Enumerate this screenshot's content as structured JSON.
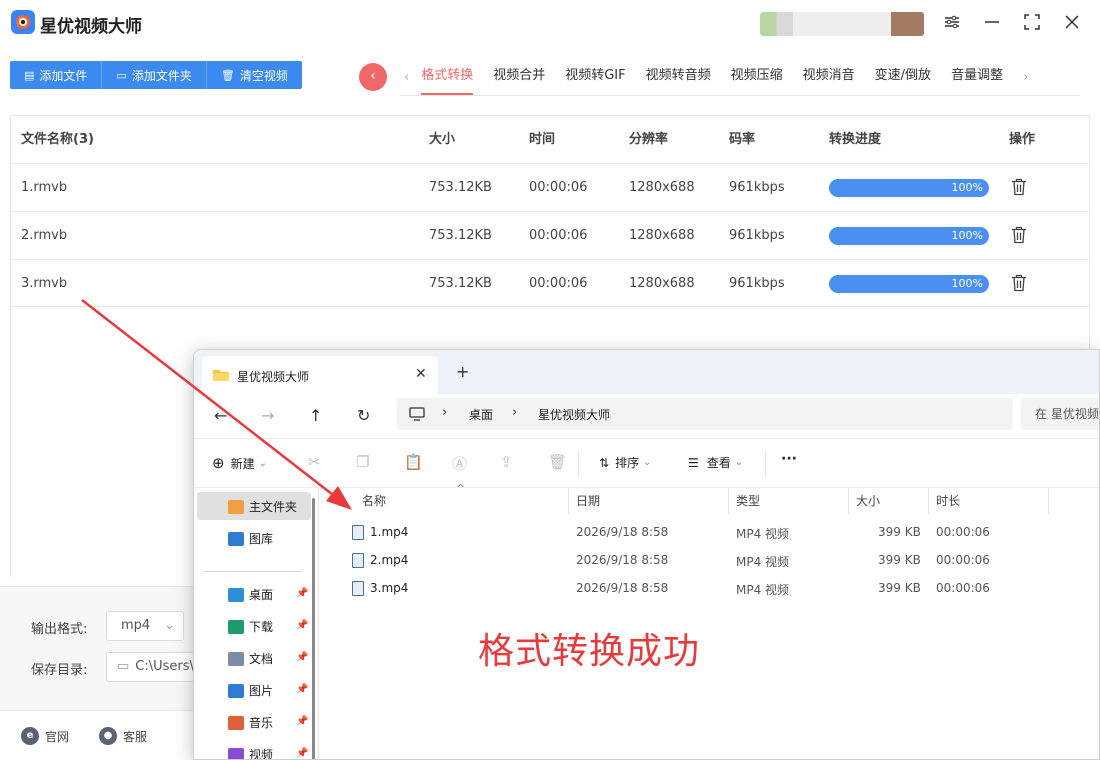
{
  "app": {
    "title": "星优视频大师",
    "toolbar": {
      "add_file": "添加文件",
      "add_folder": "添加文件夹",
      "clear_videos": "清空视频"
    },
    "tabs": [
      "格式转换",
      "视频合并",
      "视频转GIF",
      "视频转音频",
      "视频压缩",
      "视频消音",
      "变速/倒放",
      "音量调整"
    ],
    "active_tab": "格式转换",
    "table": {
      "headers": {
        "name": "文件名称(3)",
        "size": "大小",
        "time": "时间",
        "resolution": "分辨率",
        "bitrate": "码率",
        "progress": "转换进度",
        "action": "操作"
      },
      "rows": [
        {
          "name": "1.rmvb",
          "size": "753.12KB",
          "time": "00:00:06",
          "resolution": "1280x688",
          "bitrate": "961kbps",
          "progress": 1.0,
          "progress_label": "100%"
        },
        {
          "name": "2.rmvb",
          "size": "753.12KB",
          "time": "00:00:06",
          "resolution": "1280x688",
          "bitrate": "961kbps",
          "progress": 1.0,
          "progress_label": "100%"
        },
        {
          "name": "3.rmvb",
          "size": "753.12KB",
          "time": "00:00:06",
          "resolution": "1280x688",
          "bitrate": "961kbps",
          "progress": 1.0,
          "progress_label": "100%"
        }
      ]
    },
    "settings": {
      "output_format_label": "输出格式:",
      "output_format_value": "mp4",
      "save_dir_label": "保存目录:",
      "save_dir_value": "C:\\Users\\y"
    },
    "footer": {
      "website": "官网",
      "support": "客服"
    },
    "colors": {
      "accent": "#3b8af0",
      "active_tab": "#f06868",
      "progress": "#4a90f0"
    }
  },
  "explorer": {
    "tab_title": "星优视频大师",
    "breadcrumb": [
      "桌面",
      "星优视频大师"
    ],
    "search_placeholder": "在 星优视频",
    "commands": {
      "new": "新建",
      "sort": "排序",
      "view": "查看",
      "more": "···"
    },
    "nav_items": [
      {
        "label": "主文件夹",
        "icon": "home-icon",
        "pinned": false
      },
      {
        "label": "图库",
        "icon": "gallery-icon",
        "pinned": false
      },
      {
        "label": "桌面",
        "icon": "desktop-icon",
        "pinned": true
      },
      {
        "label": "下载",
        "icon": "download-icon",
        "pinned": true
      },
      {
        "label": "文档",
        "icon": "document-icon",
        "pinned": true
      },
      {
        "label": "图片",
        "icon": "pictures-icon",
        "pinned": true
      },
      {
        "label": "音乐",
        "icon": "music-icon",
        "pinned": true
      },
      {
        "label": "视频",
        "icon": "video-icon",
        "pinned": true
      }
    ],
    "columns": {
      "name": "名称",
      "date": "日期",
      "type": "类型",
      "size": "大小",
      "duration": "时长"
    },
    "files": [
      {
        "name": "1.mp4",
        "date": "2026/9/18 8:58",
        "type": "MP4 视频",
        "size": "399 KB",
        "duration": "00:00:06"
      },
      {
        "name": "2.mp4",
        "date": "2026/9/18 8:58",
        "type": "MP4 视频",
        "size": "399 KB",
        "duration": "00:00:06"
      },
      {
        "name": "3.mp4",
        "date": "2026/9/18 8:58",
        "type": "MP4 视频",
        "size": "399 KB",
        "duration": "00:00:06"
      }
    ]
  },
  "annotation": {
    "text": "格式转换成功",
    "color": "#e83a3a"
  }
}
